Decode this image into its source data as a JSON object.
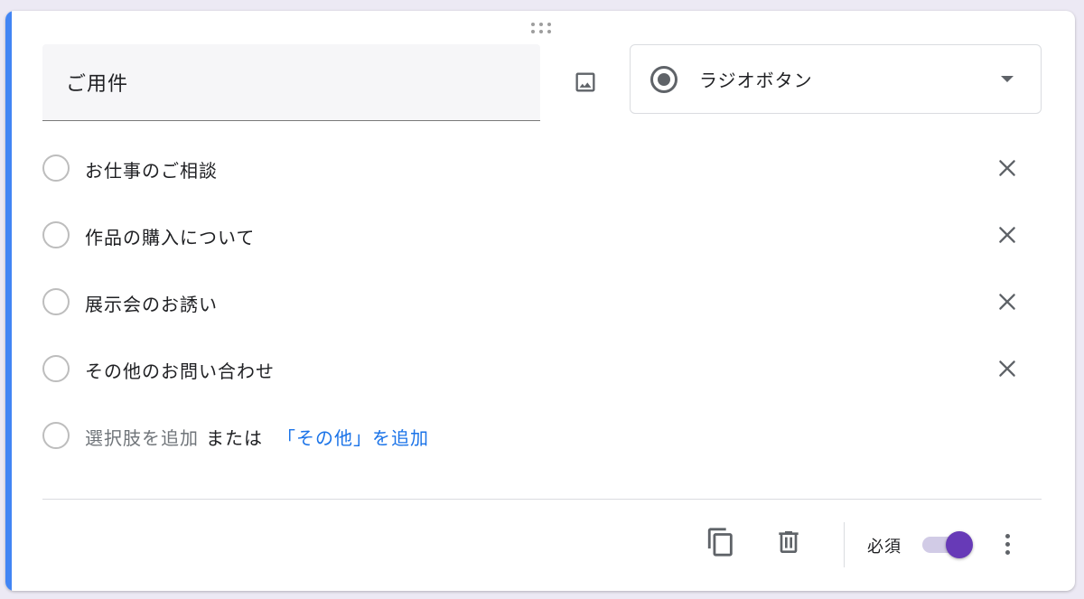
{
  "question": {
    "title": "ご用件",
    "type_label": "ラジオボタン"
  },
  "options": [
    {
      "label": "お仕事のご相談"
    },
    {
      "label": "作品の購入について"
    },
    {
      "label": "展示会のお誘い"
    },
    {
      "label": "その他のお問い合わせ"
    }
  ],
  "add_option": {
    "add_label": "選択肢を追加",
    "or_label": "または",
    "add_other_label": "「その他」を追加"
  },
  "footer": {
    "required_label": "必須",
    "required_on": true
  },
  "icons": {
    "drag": "drag-handle-icon",
    "image": "image-icon",
    "type": "radio-button-icon",
    "dropdown": "caret-down-icon",
    "remove": "close-icon",
    "duplicate": "copy-icon",
    "delete": "trash-icon",
    "more": "more-vert-icon"
  },
  "colors": {
    "accent": "#4285f4",
    "toggle_on": "#673ab7",
    "link": "#1a73e8"
  }
}
